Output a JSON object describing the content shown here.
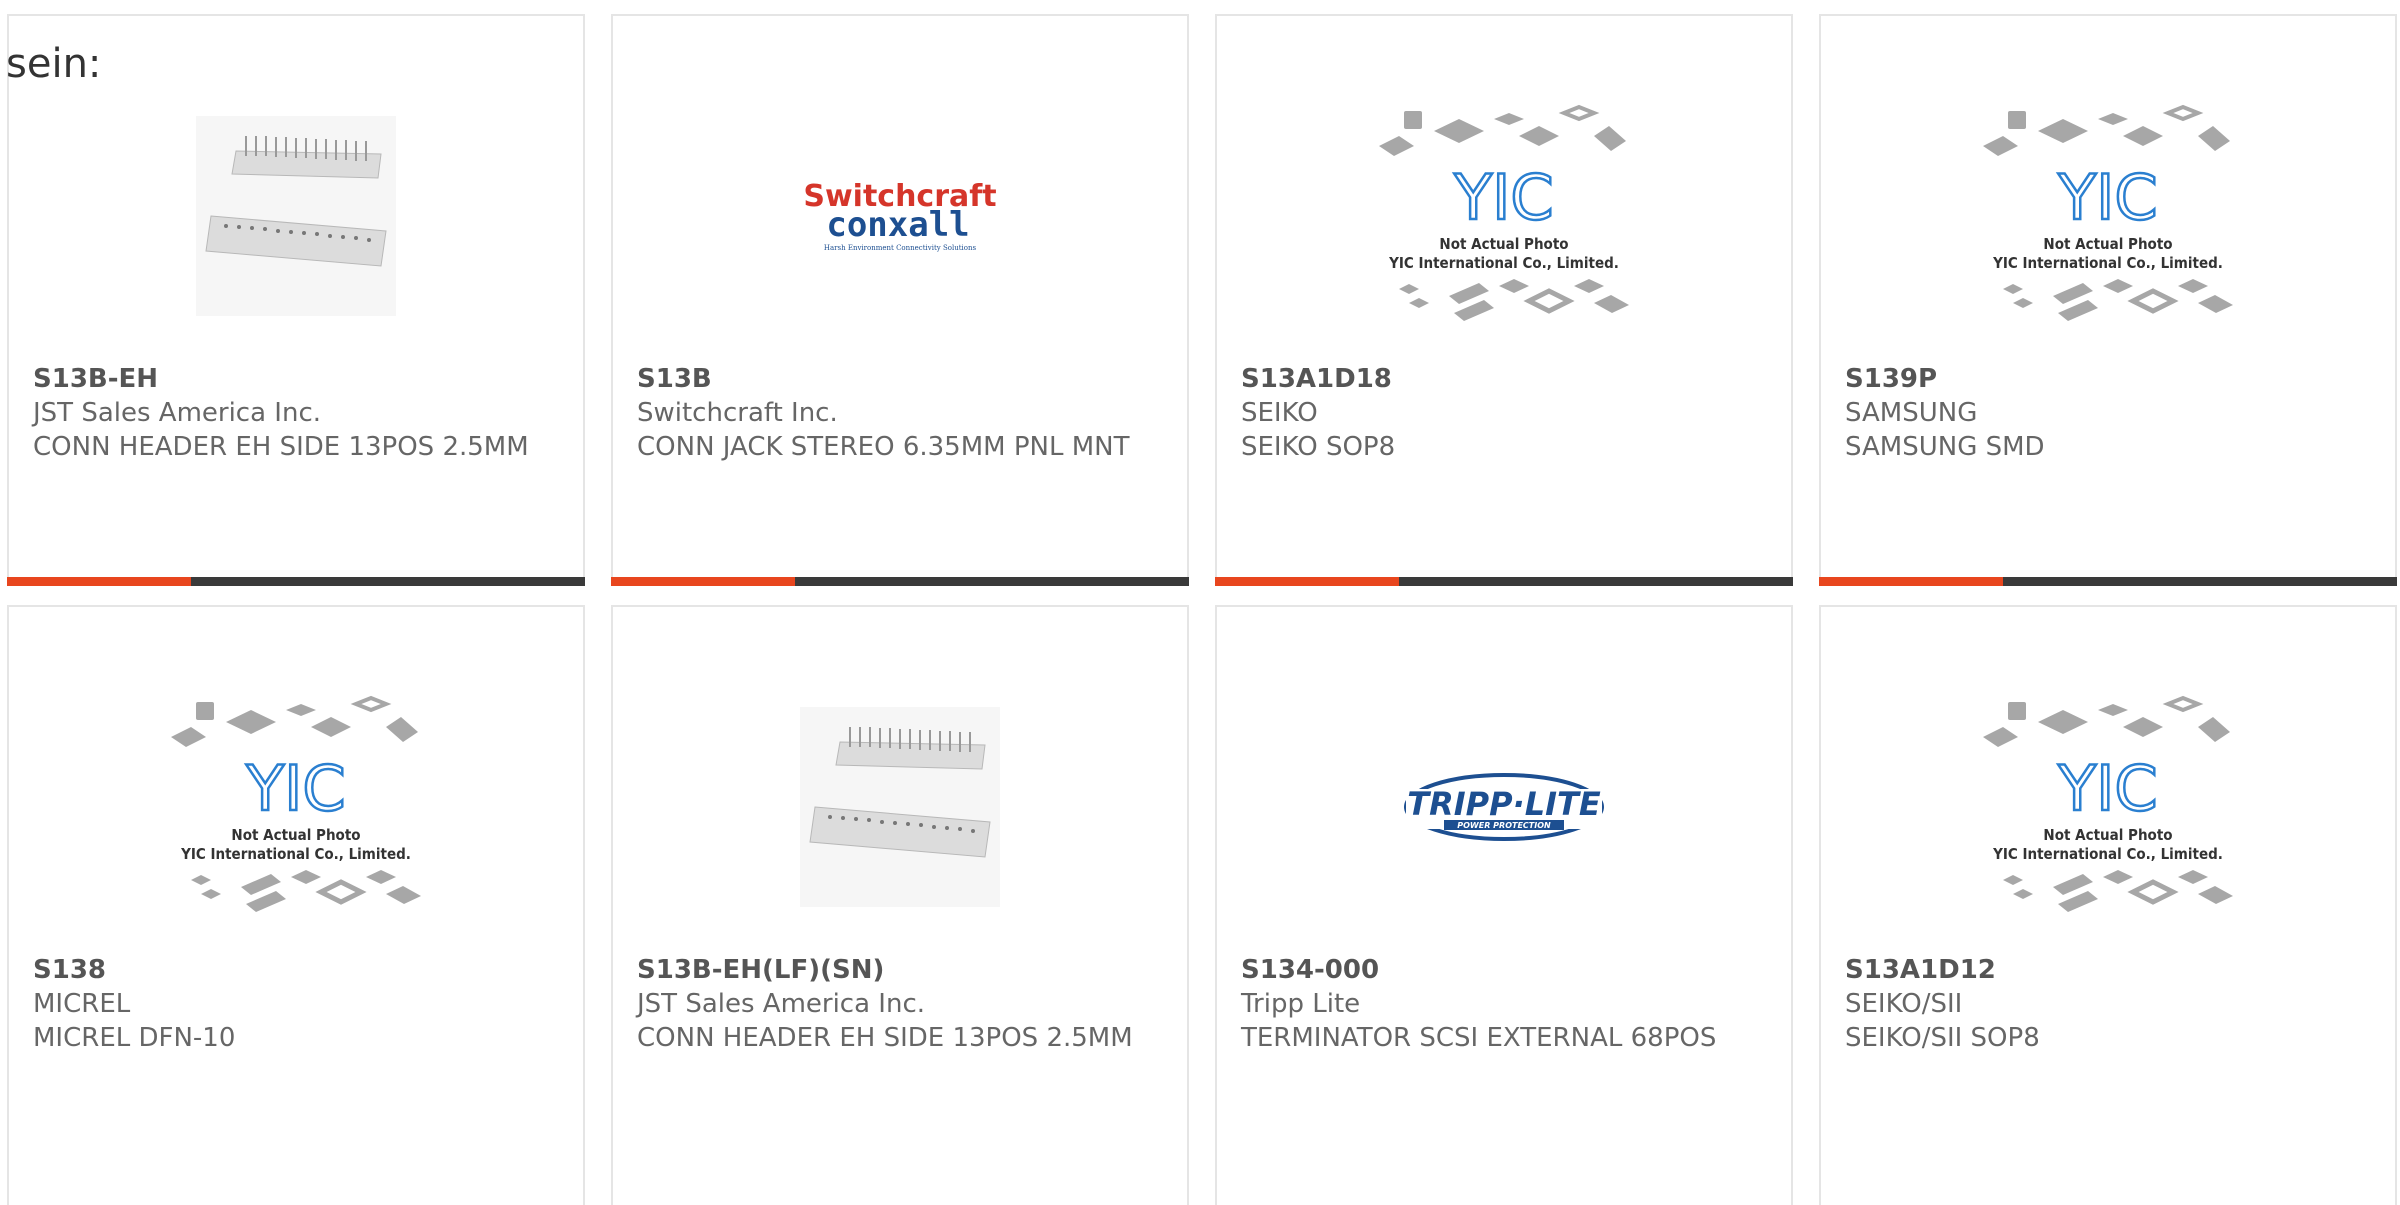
{
  "page": {
    "lead_text": "sein:"
  },
  "products": [
    {
      "part": "S13B-EH",
      "manufacturer": "JST Sales America Inc.",
      "description": "CONN HEADER EH SIDE 13POS 2.5MM",
      "image": "connector-header-photo"
    },
    {
      "part": "S13B",
      "manufacturer": "Switchcraft Inc.",
      "description": "CONN JACK STEREO 6.35MM PNL MNT",
      "image": "switchcraft-conxall-logo",
      "logo_line1": "Switchcraft",
      "logo_line2": "conxall",
      "logo_tag": "Harsh Environment Connectivity Solutions"
    },
    {
      "part": "S13A1D18",
      "manufacturer": "SEIKO",
      "description": "SEIKO SOP8",
      "image": "yic-placeholder"
    },
    {
      "part": "S139P",
      "manufacturer": "SAMSUNG",
      "description": "SAMSUNG SMD",
      "image": "yic-placeholder"
    },
    {
      "part": "S138",
      "manufacturer": "MICREL",
      "description": "MICREL DFN-10",
      "image": "yic-placeholder"
    },
    {
      "part": "S13B-EH(LF)(SN)",
      "manufacturer": "JST Sales America Inc.",
      "description": "CONN HEADER EH SIDE 13POS 2.5MM",
      "image": "connector-header-photo"
    },
    {
      "part": "S134-000",
      "manufacturer": "Tripp Lite",
      "description": "TERMINATOR SCSI EXTERNAL 68POS",
      "image": "tripp-lite-logo",
      "logo_text": "TRIPP·LITE",
      "logo_tag": "POWER PROTECTION"
    },
    {
      "part": "S13A1D12",
      "manufacturer": "SEIKO/SII",
      "description": "SEIKO/SII SOP8",
      "image": "yic-placeholder"
    }
  ],
  "placeholder": {
    "logo": "YIC",
    "line1": "Not Actual Photo",
    "line2": "YIC International Co., Limited."
  },
  "colors": {
    "accent": "#e8461e",
    "bar": "#3a3a3a",
    "border": "#e5e5e5",
    "yic_blue": "#2a7fd0"
  }
}
